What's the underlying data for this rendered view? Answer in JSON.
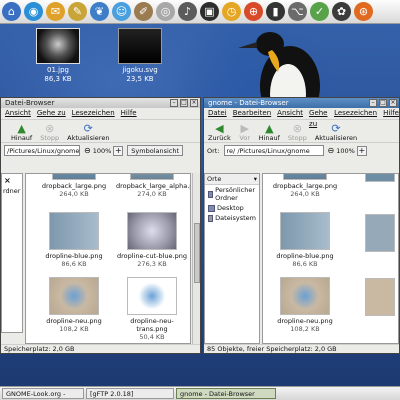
{
  "panel": {
    "launchers": [
      {
        "icon": "home-icon",
        "color": "#3a6fc2",
        "glyph": "⌂"
      },
      {
        "icon": "globe-icon",
        "color": "#2a8fd6",
        "glyph": "◉"
      },
      {
        "icon": "mail-icon",
        "color": "#e0a12a",
        "glyph": "✉"
      },
      {
        "icon": "pencil-icon",
        "color": "#c8a536",
        "glyph": "✎"
      },
      {
        "icon": "bird-icon",
        "color": "#3e7dc8",
        "glyph": "❦"
      },
      {
        "icon": "chat-icon",
        "color": "#4aa0de",
        "glyph": "☺"
      },
      {
        "icon": "brush-icon",
        "color": "#9b7b50",
        "glyph": "✐"
      },
      {
        "icon": "cd-icon",
        "color": "#a8a8a8",
        "glyph": "◎"
      },
      {
        "icon": "music-icon",
        "color": "#5b5b5b",
        "glyph": "♪"
      },
      {
        "icon": "monitor-icon",
        "color": "#2d2d2d",
        "glyph": "▣"
      },
      {
        "icon": "clock-icon",
        "color": "#e5a723",
        "glyph": "◷"
      },
      {
        "icon": "lifering-icon",
        "color": "#d94a2b",
        "glyph": "⊕"
      },
      {
        "icon": "terminal-icon",
        "color": "#333333",
        "glyph": "▮"
      },
      {
        "icon": "mouse-icon",
        "color": "#6b6b6b",
        "glyph": "⌥"
      },
      {
        "icon": "tools-icon",
        "color": "#58a34a",
        "glyph": "✓"
      },
      {
        "icon": "gnome-foot-icon",
        "color": "#3b3b3b",
        "glyph": "✿"
      },
      {
        "icon": "ubuntu-icon",
        "color": "#e06a1f",
        "glyph": "⊛"
      }
    ]
  },
  "desktop": {
    "icons": [
      {
        "name": "01.jpg",
        "size": "86,3 KB"
      },
      {
        "name": "jigoku.svg",
        "size": "23,5 KB"
      }
    ]
  },
  "left_window": {
    "title": "Datei-Browser",
    "menu": [
      "Ansicht",
      "Gehe zu",
      "Lesezeichen",
      "Hilfe"
    ],
    "toolbar": [
      {
        "label": "Hinauf",
        "icon": "up-arrow-icon"
      },
      {
        "label": "Stopp",
        "icon": "stop-icon"
      },
      {
        "label": "Aktualisieren",
        "icon": "reload-icon"
      }
    ],
    "location": "/Pictures/Linux/gnome",
    "zoom": "100%",
    "view_button": "Symbolansicht",
    "side_label": "rdner",
    "files": [
      {
        "name": "dropback_large.png",
        "size": "264,0 KB"
      },
      {
        "name": "dropback_large_alpha.png",
        "size": "274,0 KB"
      },
      {
        "name": "dropline-blue.png",
        "size": "86,6 KB"
      },
      {
        "name": "dropline-cut-blue.png",
        "size": "276,3 KB"
      },
      {
        "name": "dropline-neu.png",
        "size": "108,2 KB"
      },
      {
        "name": "dropline-neu-trans.png",
        "size": "50,4 KB"
      }
    ],
    "status": "Speicherplatz: 2,0 GB"
  },
  "right_window": {
    "title": "gnome - Datei-Browser",
    "menu": [
      "Datei",
      "Bearbeiten",
      "Ansicht",
      "Gehe zu",
      "Lesezeichen",
      "Hilfe"
    ],
    "toolbar": [
      {
        "label": "Zurück",
        "icon": "back-arrow-icon"
      },
      {
        "label": "Vor",
        "icon": "forward-arrow-icon"
      },
      {
        "label": "Hinauf",
        "icon": "up-arrow-icon"
      },
      {
        "label": "Stopp",
        "icon": "stop-icon"
      },
      {
        "label": "Aktualisieren",
        "icon": "reload-icon"
      }
    ],
    "location_label": "Ort:",
    "location": "re/   /Pictures/Linux/gnome",
    "zoom": "100%",
    "side_select": "Orte",
    "places": [
      "Persönlicher Ordner",
      "Desktop",
      "Dateisystem"
    ],
    "files": [
      {
        "name": "dropback_large.png",
        "size": "264,0 KB"
      },
      {
        "name": "dropline-blue.png",
        "size": "86,6 KB"
      },
      {
        "name": "dropline-neu.png",
        "size": "108,2 KB"
      }
    ],
    "status": "85 Objekte, freier Speicherplatz: 2,0 GB"
  },
  "taskbar": {
    "tasks": [
      "GNOME-Look.org -",
      "[gFTP 2.0.18]",
      "gnome - Datei-Browser"
    ]
  }
}
